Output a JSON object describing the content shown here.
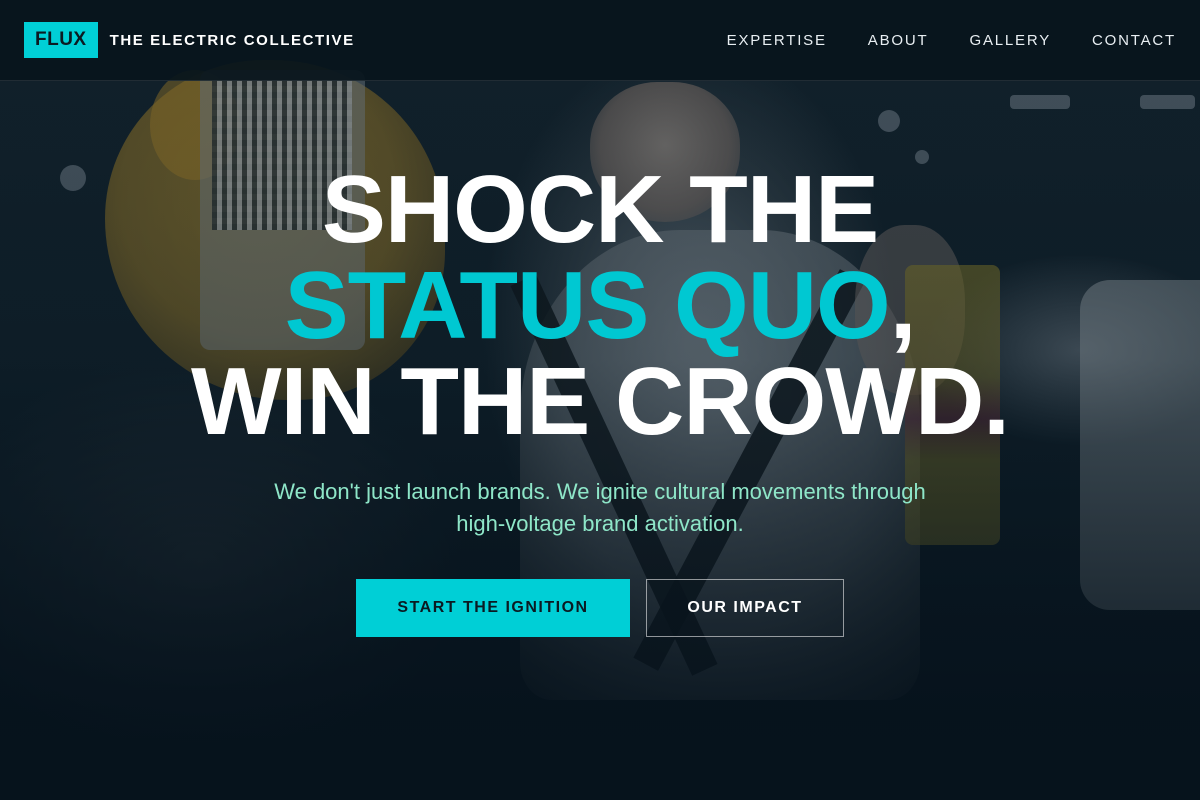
{
  "brand": {
    "logo_text": "FLUX",
    "name": "THE ELECTRIC COLLECTIVE"
  },
  "nav": {
    "items": [
      {
        "label": "EXPERTISE"
      },
      {
        "label": "ABOUT"
      },
      {
        "label": "GALLERY"
      },
      {
        "label": "CONTACT"
      }
    ]
  },
  "hero": {
    "headline_line1": "SHOCK THE",
    "headline_line2": "STATUS QUO",
    "headline_line2_punct": ",",
    "headline_line3": "WIN THE CROWD.",
    "subheadline": "We don't just launch brands. We ignite cultural movements through high-voltage brand activation.",
    "primary_cta": "START THE IGNITION",
    "secondary_cta": "OUR IMPACT",
    "background_image": "photo-promoter-woman-peace-sign-mascot-qr-sign"
  },
  "colors": {
    "accent": "#00cfd6",
    "subhead": "#8ee6c8",
    "background": "#07141c",
    "text": "#ffffff"
  }
}
